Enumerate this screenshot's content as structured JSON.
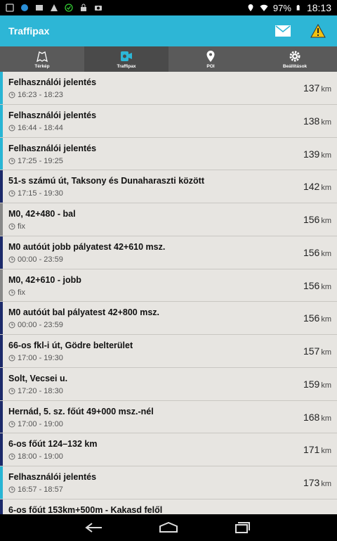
{
  "status": {
    "battery": "97%",
    "time": "18:13"
  },
  "app": {
    "title": "Traffipax"
  },
  "tabs": [
    {
      "label": "Térkép",
      "icon": "map-icon"
    },
    {
      "label": "Traffipax",
      "icon": "speed-camera-icon"
    },
    {
      "label": "POI",
      "icon": "location-pin-icon"
    },
    {
      "label": "Beállítások",
      "icon": "gear-icon"
    }
  ],
  "items": [
    {
      "title": "Felhasználói jelentés",
      "sub": "16:23 - 18:23",
      "dist": "137",
      "unit": "km",
      "color": "#29b5d4"
    },
    {
      "title": "Felhasználói jelentés",
      "sub": "16:44 - 18:44",
      "dist": "138",
      "unit": "km",
      "color": "#29b5d4"
    },
    {
      "title": "Felhasználói jelentés",
      "sub": "17:25 - 19:25",
      "dist": "139",
      "unit": "km",
      "color": "#29b5d4"
    },
    {
      "title": "51-s számú út, Taksony és Dunaharaszti között",
      "sub": "17:15 - 19:30",
      "dist": "142",
      "unit": "km",
      "color": "#1c2a6a"
    },
    {
      "title": "M0, 42+480 - bal",
      "sub": "fix",
      "dist": "156",
      "unit": "km",
      "color": "#888888"
    },
    {
      "title": "M0 autóút jobb pályatest 42+610 msz.",
      "sub": "00:00 - 23:59",
      "dist": "156",
      "unit": "km",
      "color": "#1c2a6a"
    },
    {
      "title": "M0, 42+610 - jobb",
      "sub": "fix",
      "dist": "156",
      "unit": "km",
      "color": "#888888"
    },
    {
      "title": "M0 autóút bal pályatest 42+800 msz.",
      "sub": "00:00 - 23:59",
      "dist": "156",
      "unit": "km",
      "color": "#1c2a6a"
    },
    {
      "title": "66-os fkl-i út, Gödre belterület",
      "sub": "17:00 - 19:30",
      "dist": "157",
      "unit": "km",
      "color": "#1c2a6a"
    },
    {
      "title": "Solt, Vecsei u.",
      "sub": "17:20 - 18:30",
      "dist": "159",
      "unit": "km",
      "color": "#1c2a6a"
    },
    {
      "title": "Hernád, 5. sz. főút 49+000 msz.-nél",
      "sub": "17:00 - 19:00",
      "dist": "168",
      "unit": "km",
      "color": "#1c2a6a"
    },
    {
      "title": "6-os főút 124–132 km",
      "sub": "18:00 - 19:00",
      "dist": "171",
      "unit": "km",
      "color": "#1c2a6a"
    },
    {
      "title": "Felhasználói jelentés",
      "sub": "16:57 - 18:57",
      "dist": "173",
      "unit": "km",
      "color": "#29b5d4"
    },
    {
      "title": "6-os főút 153km+500m - Kakasd felől",
      "sub": "",
      "dist": "",
      "unit": "",
      "color": "#1c2a6a"
    }
  ]
}
